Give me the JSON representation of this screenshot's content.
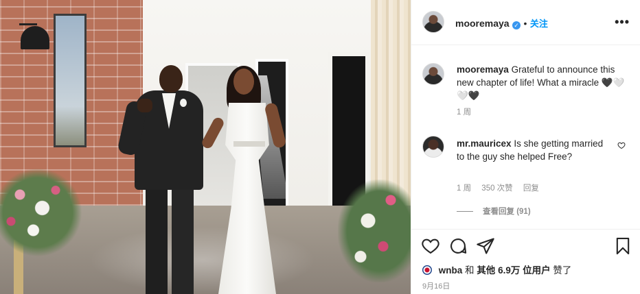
{
  "post": {
    "author": "mooremaya",
    "follow_label": "关注",
    "dot": "•",
    "more": "•••"
  },
  "caption": {
    "author": "mooremaya",
    "text": "Grateful to announce this new chapter of life! What a miracle 🖤🤍🤍🖤",
    "time": "1 周"
  },
  "comments": [
    {
      "author": "mr.mauricex",
      "text": "Is she getting married to the guy she helped Free?",
      "time": "1 周",
      "likes": "350 次赞",
      "reply_label": "回复",
      "view_replies": "查看回复 (91)"
    }
  ],
  "likes": {
    "first_user": "wnba",
    "text_and": "和",
    "text_others": "其他",
    "count": "6.9万",
    "text_users": "位用户",
    "text_liked": "赞了"
  },
  "date": "9月16日",
  "icons": {
    "like": "heart-icon",
    "comment": "comment-icon",
    "share": "paper-plane-icon",
    "save": "bookmark-icon"
  },
  "colors": {
    "accent": "#0095f6",
    "verified": "#3897f0",
    "muted": "#8e8e8e"
  }
}
